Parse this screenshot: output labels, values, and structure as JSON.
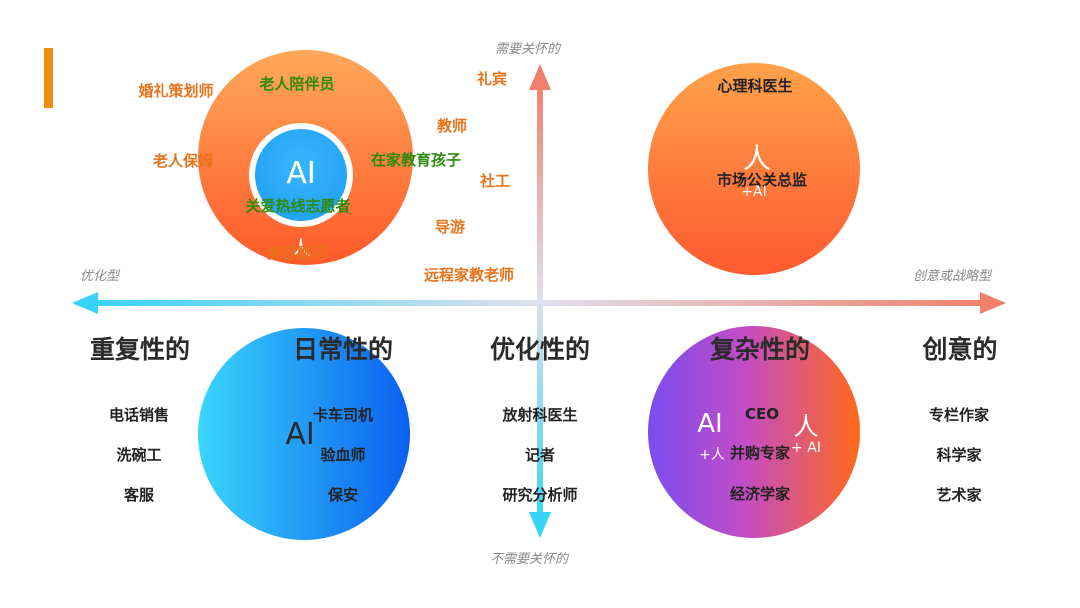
{
  "colors": {
    "accent": "#ee8a10",
    "orange_job": "#e8731c",
    "green_job": "#2e8b0e",
    "dark_job": "#222222",
    "circle_tl_top": "#ffa85a",
    "circle_tl_bottom": "#ff5a2a",
    "circle_inner": "#1e9cf0",
    "circle_tr_top": "#ffa24a",
    "circle_tr_bottom": "#ff5a30",
    "circle_bl_left": "#3ad6fb",
    "circle_bl_right": "#0a60f0",
    "circle_br_left": "#7a4cf0",
    "circle_br_right": "#ff6a1a",
    "axis_cyan": "#35d3f5",
    "axis_orange": "#f0806a"
  },
  "axes": {
    "top": "需要关怀的",
    "bottom": "不需要关怀的",
    "left": "优化型",
    "right": "创意或战略型"
  },
  "categories": [
    "重复性的",
    "日常性的",
    "优化性的",
    "复杂性的",
    "创意的"
  ],
  "quadrant_tl": {
    "inner": "AI",
    "marker": "人",
    "green": [
      "老人陪伴员",
      "在家教育孩子",
      "关爱热线志愿者"
    ],
    "orange_in": [
      "婚礼策划师",
      "老人保姆",
      "美容顾问"
    ],
    "orange_out": [
      "礼宾",
      "教师",
      "社工",
      "导游",
      "远程家教老师"
    ]
  },
  "quadrant_tr": {
    "top": "心理科医生",
    "marker": "人",
    "title": "市场公关总监",
    "sub": "+AI"
  },
  "column_left": [
    "电话销售",
    "洗碗工",
    "客服"
  ],
  "quadrant_bl": {
    "ai": "AI",
    "jobs": [
      "卡车司机",
      "验血师",
      "保安"
    ]
  },
  "column_mid": [
    "放射科医生",
    "记者",
    "研究分析师"
  ],
  "quadrant_br": {
    "ai": "AI",
    "ceo": "CEO",
    "human": "人",
    "plus_human": "+人",
    "job": "并购专家",
    "plus_ai": "+ AI",
    "bottom": "经济学家"
  },
  "column_right": [
    "专栏作家",
    "科学家",
    "艺术家"
  ]
}
